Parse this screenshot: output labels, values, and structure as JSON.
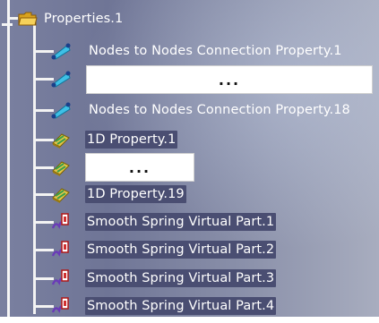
{
  "tree": {
    "root_label": "Properties.1",
    "items": [
      {
        "label": "Nodes to Nodes Connection Property.1",
        "icon": "connection-property-icon"
      },
      {
        "label": "...",
        "icon": "connection-property-icon",
        "placeholder": true
      },
      {
        "label": "Nodes to Nodes Connection Property.18",
        "icon": "connection-property-icon"
      },
      {
        "label": "1D Property.1",
        "icon": "1d-property-icon"
      },
      {
        "label": "...",
        "icon": "1d-property-icon",
        "placeholder": true
      },
      {
        "label": "1D Property.19",
        "icon": "1d-property-icon"
      },
      {
        "label": "Smooth Spring Virtual Part.1",
        "icon": "spring-virtual-part-icon"
      },
      {
        "label": "Smooth Spring Virtual Part.2",
        "icon": "spring-virtual-part-icon"
      },
      {
        "label": "Smooth Spring Virtual Part.3",
        "icon": "spring-virtual-part-icon"
      },
      {
        "label": "Smooth Spring Virtual Part.4",
        "icon": "spring-virtual-part-icon"
      }
    ]
  }
}
